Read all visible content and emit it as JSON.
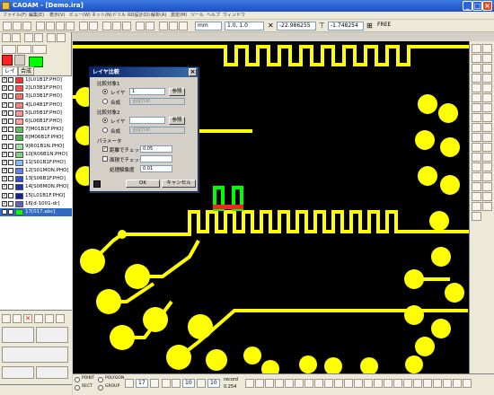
{
  "window": {
    "title": "CAOAM - [Demo.ira]",
    "min": "_",
    "max": "□",
    "close": "×"
  },
  "menu": [
    "ファイル(F)",
    "編集(E)",
    "表示(V)",
    "ビュー(W)",
    "ネット(N)",
    "ドリル",
    "RD設計(D)",
    "解析(A)",
    "測定(M)",
    "ツール",
    "ヘルプ",
    "ウィンドウ"
  ],
  "toolbar": {
    "unit": "mm",
    "scale": "1.0, 1.0",
    "coord_x": "-22.986255",
    "coord_y": "-1.748254",
    "mode": "FREE"
  },
  "left_panel": {
    "tabs": [
      "レイヤ",
      "合成"
    ],
    "layers": [
      {
        "label": "1[L01B1F.PHO]",
        "color": "#ff3030"
      },
      {
        "label": "2[L03B1F.PHO]",
        "color": "#ff5050"
      },
      {
        "label": "3[L03B1F.PHO]",
        "color": "#f07070"
      },
      {
        "label": "4[L04B1F.PHO]",
        "color": "#ff8080"
      },
      {
        "label": "5[L05B1F.PHO]",
        "color": "#ff9090"
      },
      {
        "label": "6[L06B1F.PHO]",
        "color": "#ffa0a0"
      },
      {
        "label": "7[M01B1F.PHO]",
        "color": "#60c060"
      },
      {
        "label": "8[M06B1F.PHO]",
        "color": "#50b050"
      },
      {
        "label": "9[R01B1N.PHO]",
        "color": "#a0e0a0"
      },
      {
        "label": "10[R06B1N.PHO]",
        "color": "#80d080"
      },
      {
        "label": "11[S01B1F.PHO]",
        "color": "#80c0ff"
      },
      {
        "label": "12[S01MON.PHO]",
        "color": "#6080ff"
      },
      {
        "label": "13[S06B1F.PHO]",
        "color": "#3050e0"
      },
      {
        "label": "14[S06MON.PHO]",
        "color": "#2030b0"
      },
      {
        "label": "15[L01B1F.PHO]",
        "color": "#1020a0"
      },
      {
        "label": "16[d-1001-dr]",
        "color": "#6060c0"
      },
      {
        "label": "17[017.abc]",
        "color": "#00ff00"
      }
    ]
  },
  "dialog": {
    "title": "レイヤ比較",
    "group1": "比較対象1",
    "group2": "比較対象2",
    "radio_layer": "レイヤ",
    "radio_composite": "合成",
    "ref_button": "参照",
    "composite_placeholder": "合成TOP",
    "layer_value": "1",
    "params": "パラメータ",
    "dist_check": "距離でチェック",
    "dist_value": "0.05",
    "area_check": "面積でチェック",
    "resolution_label": "処理解像度",
    "resolution_value": "0.01",
    "ok": "OK",
    "cancel": "キャンセル"
  },
  "bottom": {
    "layer_num": "17",
    "zoom_a": "10",
    "zoom_b": "10",
    "record_label": "record",
    "record_value": "0.254",
    "legend": [
      "POINT",
      "POLYGON",
      "RECT",
      "GROUP"
    ]
  },
  "colors": {
    "copper": "#ffff00",
    "background": "#000000",
    "highlight": "#00ff00",
    "diff": "#ff0000"
  }
}
